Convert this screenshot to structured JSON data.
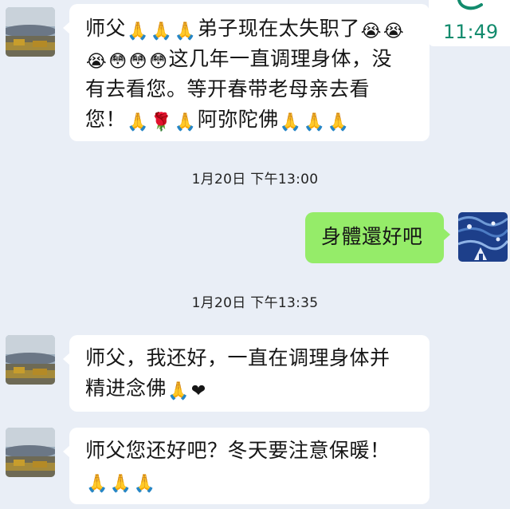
{
  "status": {
    "clock": "11:49",
    "accent_color": "#128b6d"
  },
  "colors": {
    "incoming_bubble": "#ffffff",
    "outgoing_bubble": "#95ec69",
    "background": "#e9eef6"
  },
  "messages": [
    {
      "side": "incoming",
      "avatar": "landscape-avatar-icon",
      "lines": [
        [
          "师父",
          "pray",
          "pray",
          "pray",
          "弟子现在太失职了",
          "loudly-crying",
          "loudly-crying"
        ],
        [
          "loudly-crying",
          "flushed",
          "flushed",
          "flushed",
          "这几年一直调理身体，没"
        ],
        [
          "有去看您。等开春带老母亲去看"
        ],
        [
          "您！",
          "pray",
          "rose",
          "pray",
          "阿弥陀佛",
          "pray",
          "pray",
          "pray"
        ]
      ]
    },
    {
      "side": "separator",
      "text": "1月20日 下午13:00"
    },
    {
      "side": "outgoing",
      "avatar": "starry-night-avatar-icon",
      "lines": [
        [
          "身體還好吧"
        ]
      ]
    },
    {
      "side": "separator",
      "text": "1月20日 下午13:35"
    },
    {
      "side": "incoming",
      "avatar": "landscape-avatar-icon",
      "lines": [
        [
          "师父，我还好，一直在调理身体并"
        ],
        [
          "精进念佛",
          "pray",
          "red-heart"
        ]
      ]
    },
    {
      "side": "incoming",
      "avatar": "landscape-avatar-icon",
      "lines": [
        [
          "师父您还好吧？冬天要注意保暖！"
        ],
        [
          "pray",
          "pray",
          "pray"
        ]
      ]
    }
  ],
  "emoji_glyphs": {
    "pray": "🙏",
    "loudly-crying": "😭",
    "flushed": "😳",
    "rose": "🌹",
    "red-heart": "❤"
  }
}
